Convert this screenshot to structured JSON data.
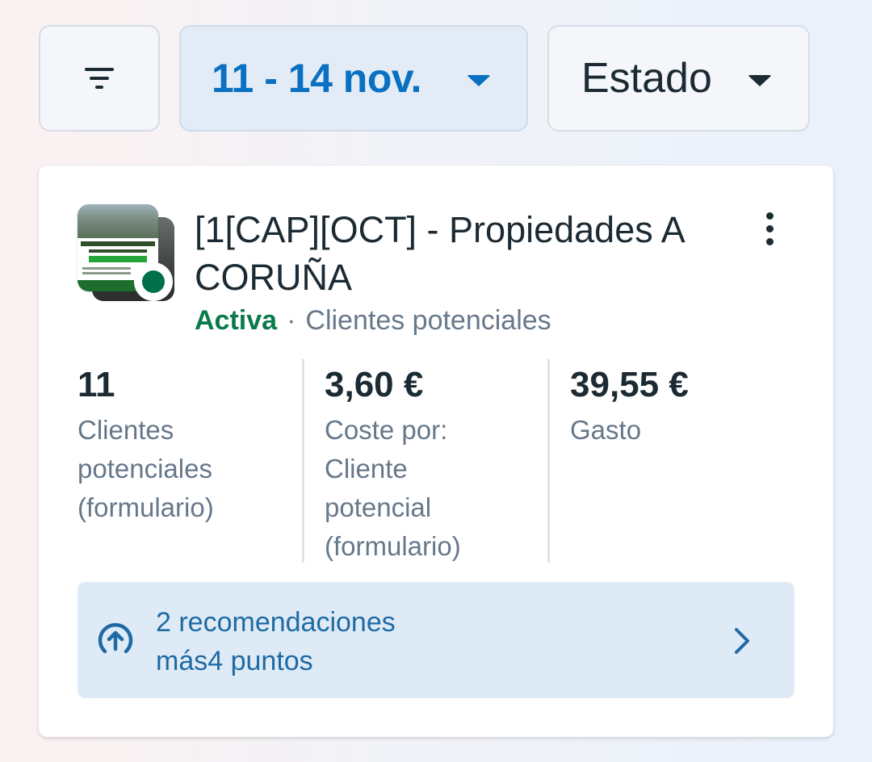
{
  "filters": {
    "filter_icon": "filter-lines-icon",
    "date_range": "11 - 14 nov.",
    "state": "Estado"
  },
  "campaign": {
    "title": "[1[CAP][OCT] - Propiedades A CORUÑA",
    "status": "Activa",
    "separator": "·",
    "objective": "Clientes potenciales",
    "status_color": "#0a7a4a",
    "thumbnail": {
      "line1": "100 COMPRADORES",
      "line2": "QUIEREN COMPRAR TU PISO",
      "line3": "EN A CORUÑA"
    },
    "metrics": [
      {
        "value": "11",
        "label": "Clientes\npotenciales\n(formulario)"
      },
      {
        "value": "3,60 €",
        "label": "Coste por:\nCliente\npotencial\n(formulario)"
      },
      {
        "value": "39,55 €",
        "label": "Gasto"
      }
    ],
    "recommendations": {
      "line1": "2 recomendaciones",
      "line2": "más4 puntos"
    }
  },
  "colors": {
    "accent": "#0a70c2",
    "active_green": "#00704a",
    "reco_background": "#deebf7"
  }
}
